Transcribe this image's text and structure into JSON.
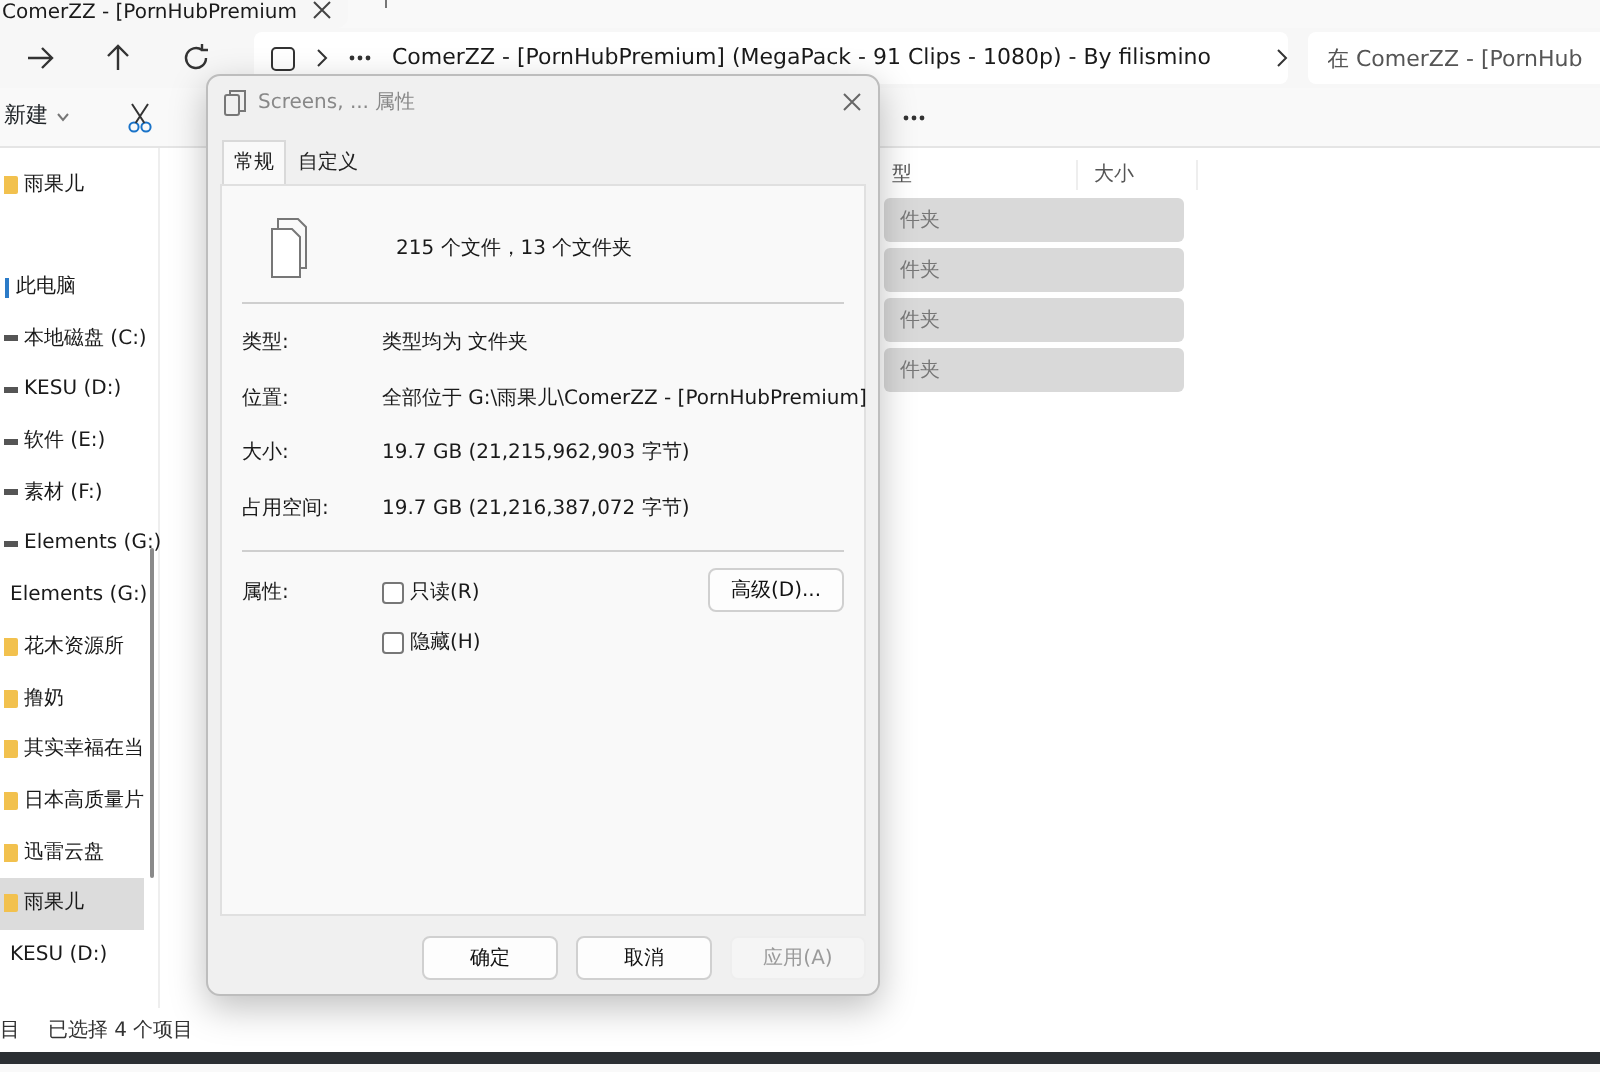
{
  "explorer": {
    "tab": {
      "title": "ComerZZ - [PornHubPremium"
    },
    "address": {
      "path": "ComerZZ - [PornHubPremium] (MegaPack - 91 Clips - 1080p) - By filismino"
    },
    "search": {
      "placeholder": "在 ComerZZ - [PornHub"
    },
    "toolbar": {
      "new_label": "新建"
    },
    "sidebar": {
      "items": [
        {
          "label": "雨果儿",
          "kind": "folder",
          "selected": false
        },
        {
          "label": "此电脑",
          "kind": "pc",
          "selected": false
        },
        {
          "label": "本地磁盘 (C:)",
          "kind": "drive",
          "selected": false
        },
        {
          "label": "KESU (D:)",
          "kind": "drive",
          "selected": false
        },
        {
          "label": "软件 (E:)",
          "kind": "drive",
          "selected": false
        },
        {
          "label": "素材 (F:)",
          "kind": "drive",
          "selected": false
        },
        {
          "label": "Elements (G:)",
          "kind": "drive",
          "selected": false
        },
        {
          "label": "Elements (G:)",
          "kind": "plain",
          "selected": false
        },
        {
          "label": "花木资源所",
          "kind": "folder",
          "selected": false
        },
        {
          "label": "撸奶",
          "kind": "folder",
          "selected": false
        },
        {
          "label": "其实幸福在当",
          "kind": "folder",
          "selected": false
        },
        {
          "label": "日本高质量片",
          "kind": "folder",
          "selected": false
        },
        {
          "label": "迅雷云盘",
          "kind": "folder",
          "selected": false
        },
        {
          "label": "雨果儿",
          "kind": "folder",
          "selected": true
        },
        {
          "label": "KESU (D:)",
          "kind": "plain",
          "selected": false
        }
      ]
    },
    "columns": [
      "型",
      "大小"
    ],
    "rows": [
      {
        "type": "件夹",
        "selected": true
      },
      {
        "type": "件夹",
        "selected": true
      },
      {
        "type": "件夹",
        "selected": true
      },
      {
        "type": "件夹",
        "selected": true
      }
    ],
    "status_bar": {
      "count": "目",
      "selection": "已选择 4 个项目"
    }
  },
  "dialog": {
    "title": "Screens, ... 属性",
    "tabs": [
      {
        "label": "常规",
        "selected": true
      },
      {
        "label": "自定义",
        "selected": false
      }
    ],
    "summary": "215 个文件，13 个文件夹",
    "properties": [
      {
        "label": "类型:",
        "value": "类型均为 文件夹"
      },
      {
        "label": "位置:",
        "value": "全部位于 G:\\雨果儿\\ComerZZ - [PornHubPremium]"
      },
      {
        "label": "大小:",
        "value": "19.7 GB (21,215,962,903 字节)"
      },
      {
        "label": "占用空间:",
        "value": "19.7 GB (21,216,387,072 字节)"
      }
    ],
    "attributes": {
      "label": "属性:",
      "checkboxes": [
        {
          "label": "只读(R)",
          "checked": false
        },
        {
          "label": "隐藏(H)",
          "checked": false
        }
      ],
      "advanced_button": "高级(D)..."
    },
    "buttons": [
      {
        "label": "确定",
        "disabled": false
      },
      {
        "label": "取消",
        "disabled": false
      },
      {
        "label": "应用(A)",
        "disabled": true
      }
    ]
  }
}
